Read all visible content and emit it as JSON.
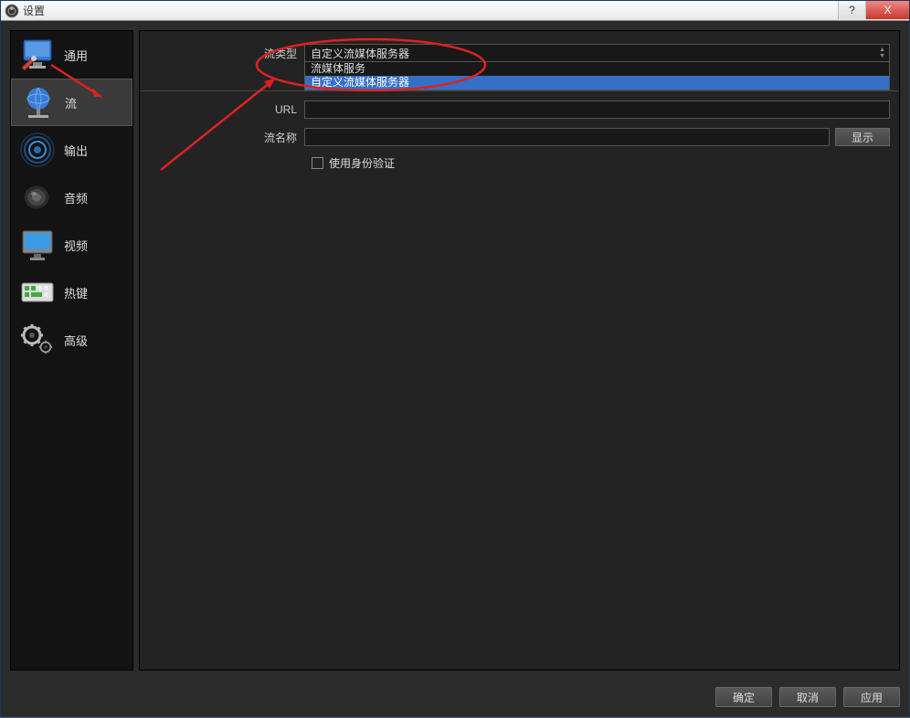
{
  "window": {
    "title": "设置"
  },
  "titlebar_buttons": {
    "help": "?",
    "close": "X"
  },
  "sidebar": {
    "items": [
      {
        "id": "general",
        "label": "通用"
      },
      {
        "id": "stream",
        "label": "流"
      },
      {
        "id": "output",
        "label": "输出"
      },
      {
        "id": "audio",
        "label": "音频"
      },
      {
        "id": "video",
        "label": "视频"
      },
      {
        "id": "hotkeys",
        "label": "热键"
      },
      {
        "id": "advanced",
        "label": "高级"
      }
    ],
    "active_index": 1
  },
  "form": {
    "stream_type_label": "流类型",
    "stream_type_value": "自定义流媒体服务器",
    "stream_type_options": [
      "流媒体服务",
      "自定义流媒体服务器"
    ],
    "url_label": "URL",
    "url_value": "",
    "stream_name_label": "流名称",
    "stream_name_value": "",
    "show_button": "显示",
    "use_auth_label": "使用身份验证"
  },
  "buttons": {
    "ok": "确定",
    "cancel": "取消",
    "apply": "应用"
  }
}
